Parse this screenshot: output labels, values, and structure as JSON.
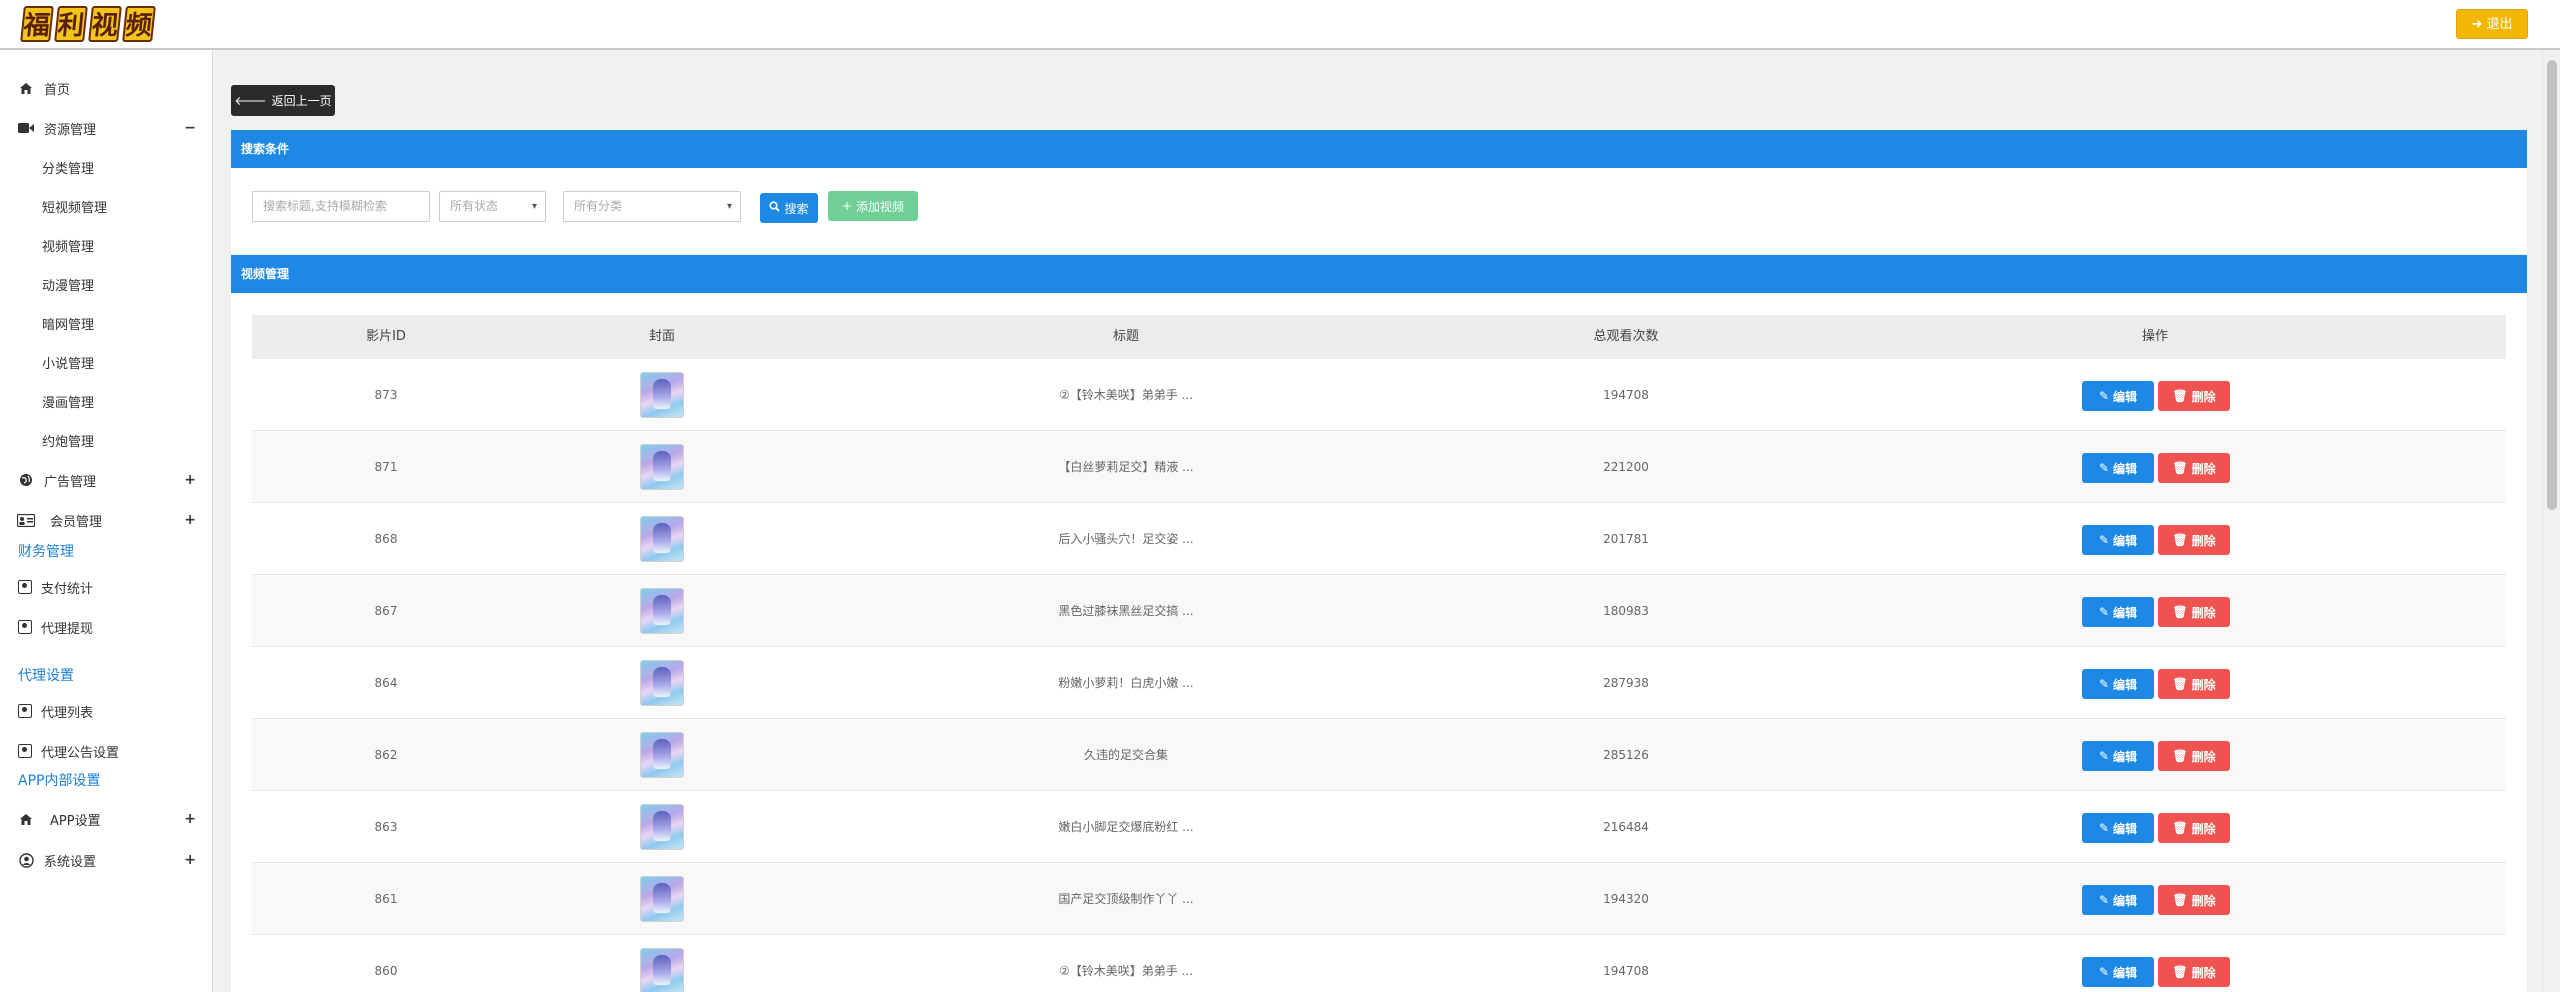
{
  "header": {
    "logo_chars": [
      "福",
      "利",
      "视",
      "频"
    ],
    "logout_label": "退出"
  },
  "sidebar": {
    "home": "首页",
    "resource": "资源管理",
    "resource_toggle": "−",
    "resource_items": [
      "分类管理",
      "短视频管理",
      "视频管理",
      "动漫管理",
      "暗网管理",
      "小说管理",
      "漫画管理",
      "约炮管理"
    ],
    "ads": "广告管理",
    "members": "会员管理",
    "finance_section": "财务管理",
    "finance_items": [
      "支付统计",
      "代理提现"
    ],
    "agent_section": "代理设置",
    "agent_items": [
      "代理列表",
      "代理公告设置"
    ],
    "app_section": "APP内部设置",
    "app_settings": "APP设置",
    "system_settings": "系统设置",
    "plus": "+"
  },
  "main": {
    "back_label": "返回上一页",
    "search_panel_title": "搜索条件",
    "search_placeholder": "搜索标题,支持模糊检索",
    "status_select": "所有状态",
    "category_select": "所有分类",
    "search_button": "搜索",
    "add_button": "添加视频",
    "video_panel_title": "视频管理"
  },
  "table": {
    "headers": [
      "影片ID",
      "封面",
      "标题",
      "总观看次数",
      "操作"
    ],
    "edit_label": "编辑",
    "delete_label": "删除",
    "rows": [
      {
        "id": "873",
        "title": "②【铃木美咲】弟弟手 ...",
        "views": "194708"
      },
      {
        "id": "871",
        "title": "【白丝萝莉足交】精液 ...",
        "views": "221200"
      },
      {
        "id": "868",
        "title": "后入小骚头穴！足交姿 ...",
        "views": "201781"
      },
      {
        "id": "867",
        "title": "黑色过膝袜黑丝足交搞 ...",
        "views": "180983"
      },
      {
        "id": "864",
        "title": "粉嫩小萝莉！白虎小嫩 ...",
        "views": "287938"
      },
      {
        "id": "862",
        "title": "久违的足交合集",
        "views": "285126"
      },
      {
        "id": "863",
        "title": "嫩白小脚足交爆底粉红 ...",
        "views": "216484"
      },
      {
        "id": "861",
        "title": "国产足交顶级制作丫丫 ...",
        "views": "194320"
      },
      {
        "id": "860",
        "title": "②【铃木美咲】弟弟手 ...",
        "views": "194708"
      }
    ]
  }
}
